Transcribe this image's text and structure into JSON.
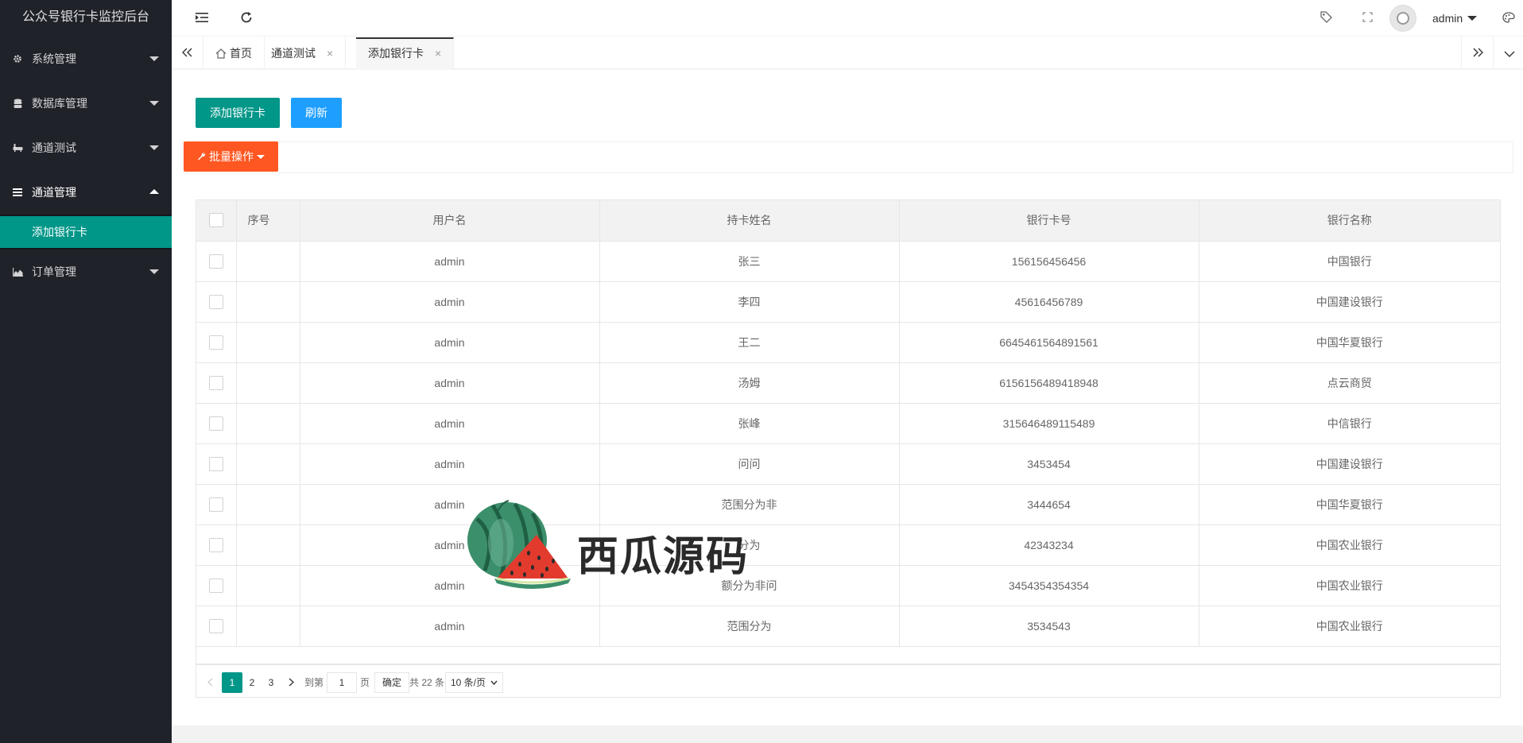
{
  "sidebar": {
    "title": "公众号银行卡监控后台",
    "items": [
      {
        "label": "系统管理",
        "icon": "gear-icon"
      },
      {
        "label": "数据库管理",
        "icon": "database-icon"
      },
      {
        "label": "通道测试",
        "icon": "bathtub-icon"
      },
      {
        "label": "通道管理",
        "icon": "menu-lines-icon"
      },
      {
        "label": "订单管理",
        "icon": "area-chart-icon"
      }
    ],
    "child_active": "添加银行卡"
  },
  "header": {
    "user": "admin"
  },
  "tabs": [
    {
      "label": "首页",
      "icon": "home-icon"
    },
    {
      "label": "通道测试"
    },
    {
      "label": "添加银行卡"
    }
  ],
  "actions": {
    "add_label": "添加银行卡",
    "refresh_label": "刷新",
    "batch_label": "批量操作"
  },
  "table": {
    "headers": [
      "序号",
      "用户名",
      "持卡姓名",
      "银行卡号",
      "银行名称"
    ],
    "rows": [
      {
        "seq": "",
        "user": "admin",
        "name": "张三",
        "card": "156156456456",
        "bank": "中国银行"
      },
      {
        "seq": "",
        "user": "admin",
        "name": "李四",
        "card": "45616456789",
        "bank": "中国建设银行"
      },
      {
        "seq": "",
        "user": "admin",
        "name": "王二",
        "card": "6645461564891561",
        "bank": "中国华夏银行"
      },
      {
        "seq": "",
        "user": "admin",
        "name": "汤姆",
        "card": "6156156489418948",
        "bank": "点云商贸"
      },
      {
        "seq": "",
        "user": "admin",
        "name": "张峰",
        "card": "315646489115489",
        "bank": "中信银行"
      },
      {
        "seq": "",
        "user": "admin",
        "name": "问问",
        "card": "3453454",
        "bank": "中国建设银行"
      },
      {
        "seq": "",
        "user": "admin",
        "name": "范围分为非",
        "card": "3444654",
        "bank": "中国华夏银行"
      },
      {
        "seq": "",
        "user": "admin",
        "name": "分为",
        "card": "42343234",
        "bank": "中国农业银行"
      },
      {
        "seq": "",
        "user": "admin",
        "name": "额分为非问",
        "card": "3454354354354",
        "bank": "中国农业银行"
      },
      {
        "seq": "",
        "user": "admin",
        "name": "范围分为",
        "card": "3534543",
        "bank": "中国农业银行"
      }
    ]
  },
  "pager": {
    "prev": "<",
    "pages": [
      "1",
      "2",
      "3"
    ],
    "current": "1",
    "next": ">",
    "goto_label": "到第",
    "goto_value": "1",
    "page_unit": "页",
    "confirm": "确定",
    "total": "共 22 条",
    "size_option": "10 条/页"
  },
  "watermark": {
    "text": "西瓜源码"
  },
  "colors": {
    "sidebar_bg": "#20222a",
    "accent": "#009688",
    "blue": "#1e9fff",
    "orange": "#ff5722"
  }
}
